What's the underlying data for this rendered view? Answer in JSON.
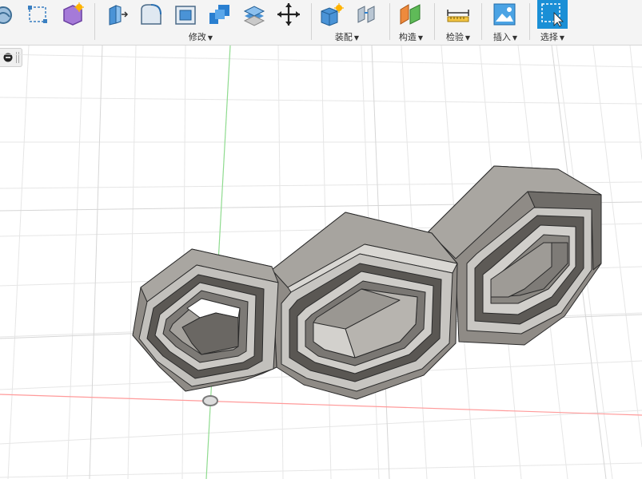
{
  "toolbar": {
    "groups": [
      {
        "id": "modify",
        "label": "修改"
      },
      {
        "id": "assemble",
        "label": "装配"
      },
      {
        "id": "construct",
        "label": "构造"
      },
      {
        "id": "inspect",
        "label": "检验"
      },
      {
        "id": "insert",
        "label": "插入"
      },
      {
        "id": "select",
        "label": "选择"
      }
    ],
    "icons": [
      "form-icon",
      "sketch-icon",
      "create-form-icon",
      "press-pull-icon",
      "fillet-icon",
      "shell-icon",
      "combine-icon",
      "offset-face-icon",
      "move-copy-icon",
      "new-component-icon",
      "joint-icon",
      "offset-plane-icon",
      "measure-icon",
      "insert-image-icon",
      "select-window-icon"
    ]
  },
  "browser_stub": {
    "icons": [
      "collapse-icon"
    ]
  },
  "viewport": {
    "colors": {
      "grid_minor": "#e9e9e9",
      "grid_major": "#dcdcdc",
      "axis_x": "#ff9a9a",
      "axis_y": "#8fdb8f",
      "model_face": "#8e8a85",
      "model_light": "#c8c6c2",
      "model_dark": "#5a5753",
      "model_edge": "#2a2a2a",
      "selected_accent": "#1a8fd6"
    }
  }
}
